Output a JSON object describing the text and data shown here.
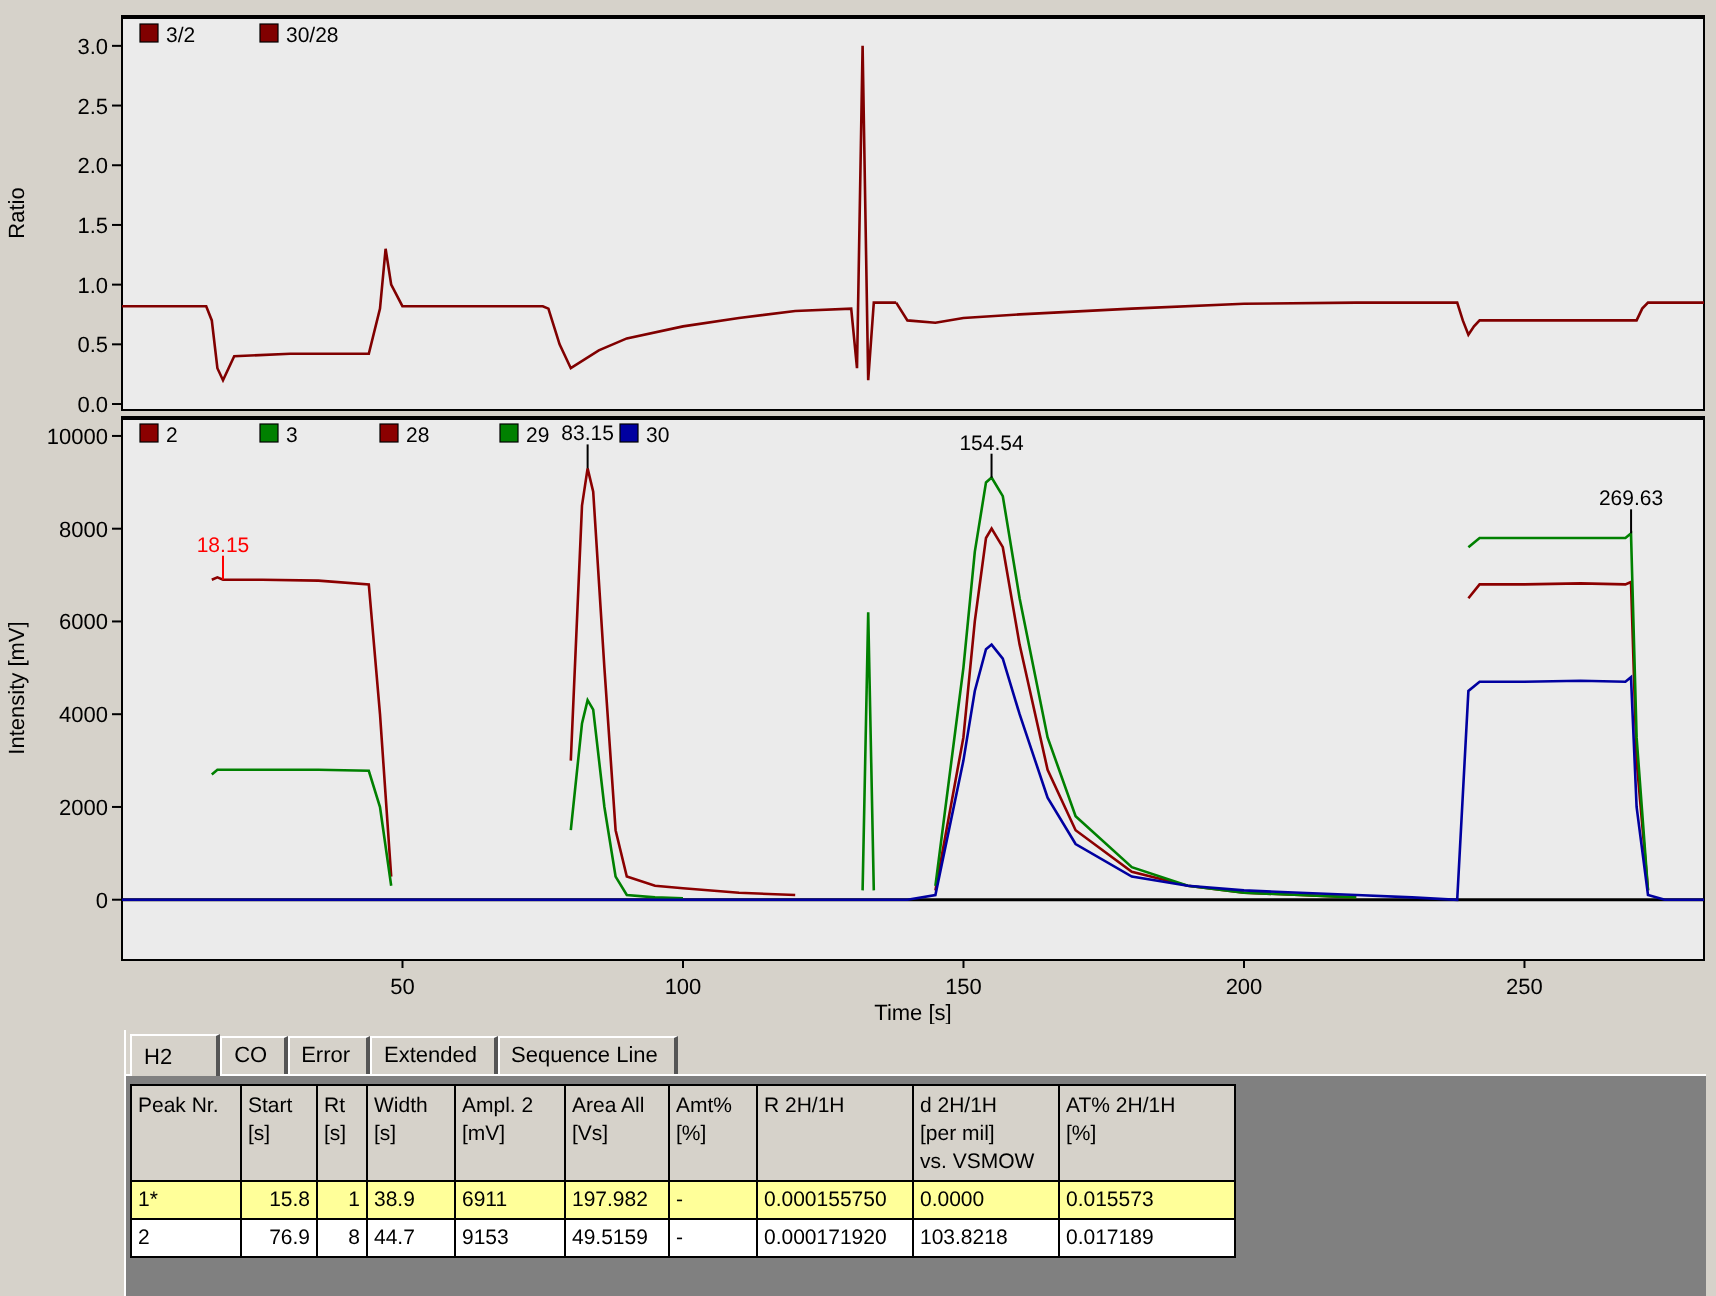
{
  "ratio_panel": {
    "chart_data": {
      "type": "line",
      "ylabel": "Ratio",
      "xlim": [
        0,
        282
      ],
      "ylim": [
        -0.05,
        3.25
      ],
      "legend": "top-left",
      "yticks": [
        {
          "value": 0,
          "label": "0.0"
        },
        {
          "value": 0.5,
          "label": "0.5"
        },
        {
          "value": 1,
          "label": "1.0"
        },
        {
          "value": 1.5,
          "label": "1.5"
        },
        {
          "value": 2,
          "label": "2.0"
        },
        {
          "value": 2.5,
          "label": "2.5"
        },
        {
          "value": 3,
          "label": "3.0"
        }
      ],
      "x": [
        0,
        15,
        16,
        17,
        18,
        20,
        30,
        44,
        46,
        47,
        48,
        50,
        55,
        75,
        76,
        78,
        80,
        85,
        90,
        100,
        110,
        120,
        130,
        131,
        132,
        133,
        134,
        135,
        138,
        140,
        145,
        150,
        160,
        180,
        200,
        220,
        238,
        239,
        240,
        241,
        242,
        250,
        260,
        270,
        271,
        272,
        275,
        282
      ],
      "series": [
        {
          "name": "3/2",
          "color": "#800000",
          "values": [
            0.82,
            0.82,
            0.7,
            0.3,
            0.2,
            0.4,
            0.42,
            0.42,
            0.8,
            1.3,
            1.0,
            0.82,
            0.82,
            0.82,
            0.8,
            0.5,
            0.3,
            0.45,
            0.55,
            0.65,
            0.72,
            0.78,
            0.8,
            0.3,
            3.0,
            0.2,
            0.85,
            0.85,
            0.85,
            null,
            null,
            null,
            null,
            null,
            null,
            null,
            null,
            null,
            null,
            null,
            null,
            null,
            null,
            null,
            null,
            null,
            null,
            null
          ]
        },
        {
          "name": "30/28",
          "color": "#800000",
          "values": [
            null,
            null,
            null,
            null,
            null,
            null,
            null,
            null,
            null,
            null,
            null,
            null,
            null,
            null,
            null,
            null,
            null,
            null,
            null,
            null,
            null,
            null,
            null,
            null,
            null,
            null,
            null,
            null,
            0.85,
            0.7,
            0.68,
            0.72,
            0.75,
            0.8,
            0.84,
            0.85,
            0.85,
            0.7,
            0.58,
            0.65,
            0.7,
            0.7,
            0.7,
            0.7,
            0.8,
            0.85,
            0.85,
            0.85
          ]
        }
      ]
    }
  },
  "intensity_panel": {
    "chart_data": {
      "type": "line",
      "xlabel": "Time [s]",
      "ylabel": "Intensity [mV]",
      "xlim": [
        0,
        282
      ],
      "ylim": [
        -1300,
        10430
      ],
      "xticks": [
        50,
        100,
        150,
        200,
        250
      ],
      "yticks": [
        0,
        2000,
        4000,
        6000,
        8000,
        10000
      ],
      "x": [
        0,
        15,
        16,
        17,
        18,
        25,
        35,
        44,
        46,
        48,
        50,
        55,
        75,
        78,
        80,
        82,
        83,
        84,
        86,
        88,
        90,
        95,
        100,
        110,
        120,
        131,
        132,
        133,
        134,
        135,
        140,
        145,
        150,
        152,
        154,
        155,
        157,
        160,
        165,
        170,
        180,
        190,
        200,
        210,
        220,
        230,
        238,
        240,
        242,
        250,
        260,
        268,
        269,
        270,
        272,
        275,
        282
      ],
      "series": [
        {
          "name": "2",
          "color": "#8b0000",
          "values": [
            null,
            null,
            6900,
            6950,
            6900,
            6900,
            6880,
            6800,
            4000,
            500,
            null,
            null,
            null,
            null,
            3000,
            8500,
            9300,
            8800,
            5000,
            1500,
            500,
            300,
            250,
            150,
            100,
            null,
            null,
            null,
            null,
            null,
            null,
            null,
            null,
            null,
            null,
            null,
            null,
            null,
            null,
            null,
            null,
            null,
            null,
            null,
            null,
            null,
            null,
            null,
            null,
            null,
            null,
            null,
            null,
            null,
            null,
            null,
            null
          ]
        },
        {
          "name": "3",
          "color": "#008000",
          "values": [
            null,
            null,
            2700,
            2800,
            2800,
            2800,
            2800,
            2780,
            2000,
            300,
            null,
            null,
            null,
            null,
            1500,
            3800,
            4300,
            4100,
            2000,
            500,
            100,
            50,
            30,
            null,
            null,
            null,
            200,
            6200,
            200,
            null,
            null,
            null,
            null,
            null,
            null,
            null,
            null,
            null,
            null,
            null,
            null,
            null,
            null,
            null,
            null,
            null,
            null,
            null,
            null,
            null,
            null,
            null,
            null,
            null,
            null,
            null,
            null
          ]
        },
        {
          "name": "28",
          "color": "#8b0000",
          "values": [
            null,
            null,
            null,
            null,
            null,
            null,
            null,
            null,
            null,
            null,
            null,
            null,
            null,
            null,
            null,
            null,
            null,
            null,
            null,
            null,
            null,
            null,
            null,
            null,
            null,
            null,
            null,
            null,
            null,
            null,
            null,
            200,
            3500,
            6000,
            7800,
            8000,
            7600,
            5500,
            2800,
            1500,
            600,
            300,
            150,
            100,
            50,
            null,
            null,
            6500,
            6800,
            6800,
            6820,
            6800,
            6850,
            3000,
            200,
            null,
            null
          ]
        },
        {
          "name": "29",
          "color": "#008000",
          "values": [
            null,
            null,
            null,
            null,
            null,
            null,
            null,
            null,
            null,
            null,
            null,
            null,
            null,
            null,
            null,
            null,
            null,
            null,
            null,
            null,
            null,
            null,
            null,
            null,
            null,
            null,
            null,
            null,
            null,
            null,
            null,
            300,
            5000,
            7500,
            9000,
            9100,
            8700,
            6500,
            3500,
            1800,
            700,
            300,
            150,
            100,
            50,
            null,
            null,
            7600,
            7800,
            7800,
            7800,
            7800,
            7900,
            3500,
            200,
            null,
            null
          ]
        },
        {
          "name": "30",
          "color": "#0000a0",
          "values": [
            0,
            0,
            0,
            0,
            0,
            0,
            0,
            0,
            0,
            0,
            0,
            0,
            0,
            0,
            0,
            0,
            0,
            0,
            0,
            0,
            0,
            0,
            0,
            0,
            0,
            0,
            0,
            0,
            0,
            0,
            0,
            100,
            3000,
            4500,
            5400,
            5500,
            5200,
            4000,
            2200,
            1200,
            500,
            300,
            200,
            150,
            100,
            50,
            0,
            4500,
            4700,
            4700,
            4720,
            4700,
            4800,
            2000,
            100,
            0,
            0
          ]
        }
      ],
      "legend": "top-left",
      "annotations": [
        {
          "x": 18,
          "y": 6900,
          "text": "18.15"
        },
        {
          "x": 83,
          "y": 9300,
          "text": "83.15"
        },
        {
          "x": 155,
          "y": 9100,
          "text": "154.54"
        },
        {
          "x": 269,
          "y": 7900,
          "text": "269.63"
        }
      ]
    }
  },
  "results": {
    "tabs": [
      {
        "label": "H2",
        "selected": true
      },
      {
        "label": "CO",
        "selected": false
      },
      {
        "label": "Error",
        "selected": false
      },
      {
        "label": "Extended",
        "selected": false
      },
      {
        "label": "Sequence Line",
        "selected": false
      }
    ],
    "columns": [
      "Peak Nr.",
      "Start\n[s]",
      "Rt\n[s]",
      "Width\n[s]",
      "Ampl. 2\n[mV]",
      "Area All\n[Vs]",
      "Amt%\n[%]",
      "R 2H/1H",
      "d 2H/1H\n[per mil]\nvs. VSMOW",
      "AT% 2H/1H\n[%]"
    ],
    "rows": [
      {
        "selected": true,
        "cells": [
          "1*",
          "15.8",
          "1",
          "38.9",
          "6911",
          "197.982",
          "-",
          "0.000155750",
          "0.0000",
          "0.015573"
        ]
      },
      {
        "selected": false,
        "cells": [
          "2",
          "76.9",
          "8",
          "44.7",
          "9153",
          "49.5159",
          "-",
          "0.000171920",
          "103.8218",
          "0.017189"
        ]
      }
    ]
  }
}
